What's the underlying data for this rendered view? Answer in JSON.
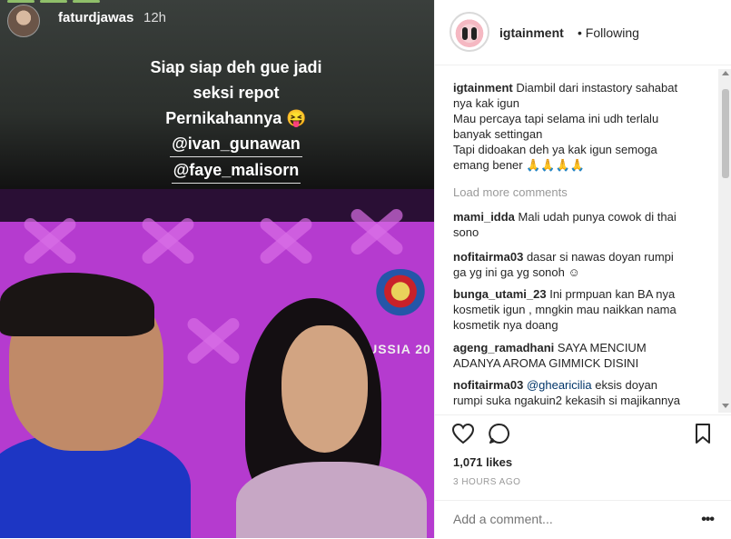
{
  "story": {
    "username": "faturdjawas",
    "time": "12h",
    "lines": [
      "Siap siap deh gue jadi",
      "seksi repot",
      "Pernikahannya 😝"
    ],
    "mentions": [
      "@ivan_gunawan",
      "@faye_malisorn"
    ],
    "logo_text": "RUSSIA 20"
  },
  "post": {
    "header": {
      "username": "igtainment",
      "separator": "•",
      "follow_status": "Following"
    },
    "caption": {
      "username": "igtainment",
      "lines": [
        "Diambil dari instastory sahabat",
        "nya kak igun",
        "Mau percaya tapi selama ini udh terlalu",
        "banyak settingan",
        "Tapi didoakan deh ya kak igun semoga",
        "emang bener 🙏🙏🙏🙏"
      ]
    },
    "load_more": "Load more comments",
    "comments": [
      {
        "user": "mami_idda",
        "lines": [
          "Mali udah punya cowok di thai",
          "sono"
        ]
      },
      {
        "user": "nofitairma03",
        "lines": [
          "dasar si nawas doyan rumpi",
          "ga yg ini ga yg sonoh ☺"
        ]
      },
      {
        "user": "bunga_utami_23",
        "lines": [
          "Ini prmpuan kan BA nya",
          "kosmetik igun , mngkin mau naikkan nama",
          "kosmetik nya doang"
        ]
      },
      {
        "user": "ageng_ramadhani",
        "lines": [
          "SAYA MENCIUM",
          "ADANYA AROMA GIMMICK DISINI"
        ]
      },
      {
        "user": "nofitairma03",
        "mention": "@ghearicilia",
        "lines": [
          "eksis doyan",
          "rumpi suka ngakuin2 kekasih si majikannya"
        ]
      }
    ],
    "likes": "1,071 likes",
    "time_ago": "3 HOURS AGO",
    "add_comment_placeholder": "Add a comment...",
    "more_label": "•••"
  },
  "icons": {
    "like": "heart-icon",
    "comment": "comment-bubble-icon",
    "save": "bookmark-icon"
  }
}
